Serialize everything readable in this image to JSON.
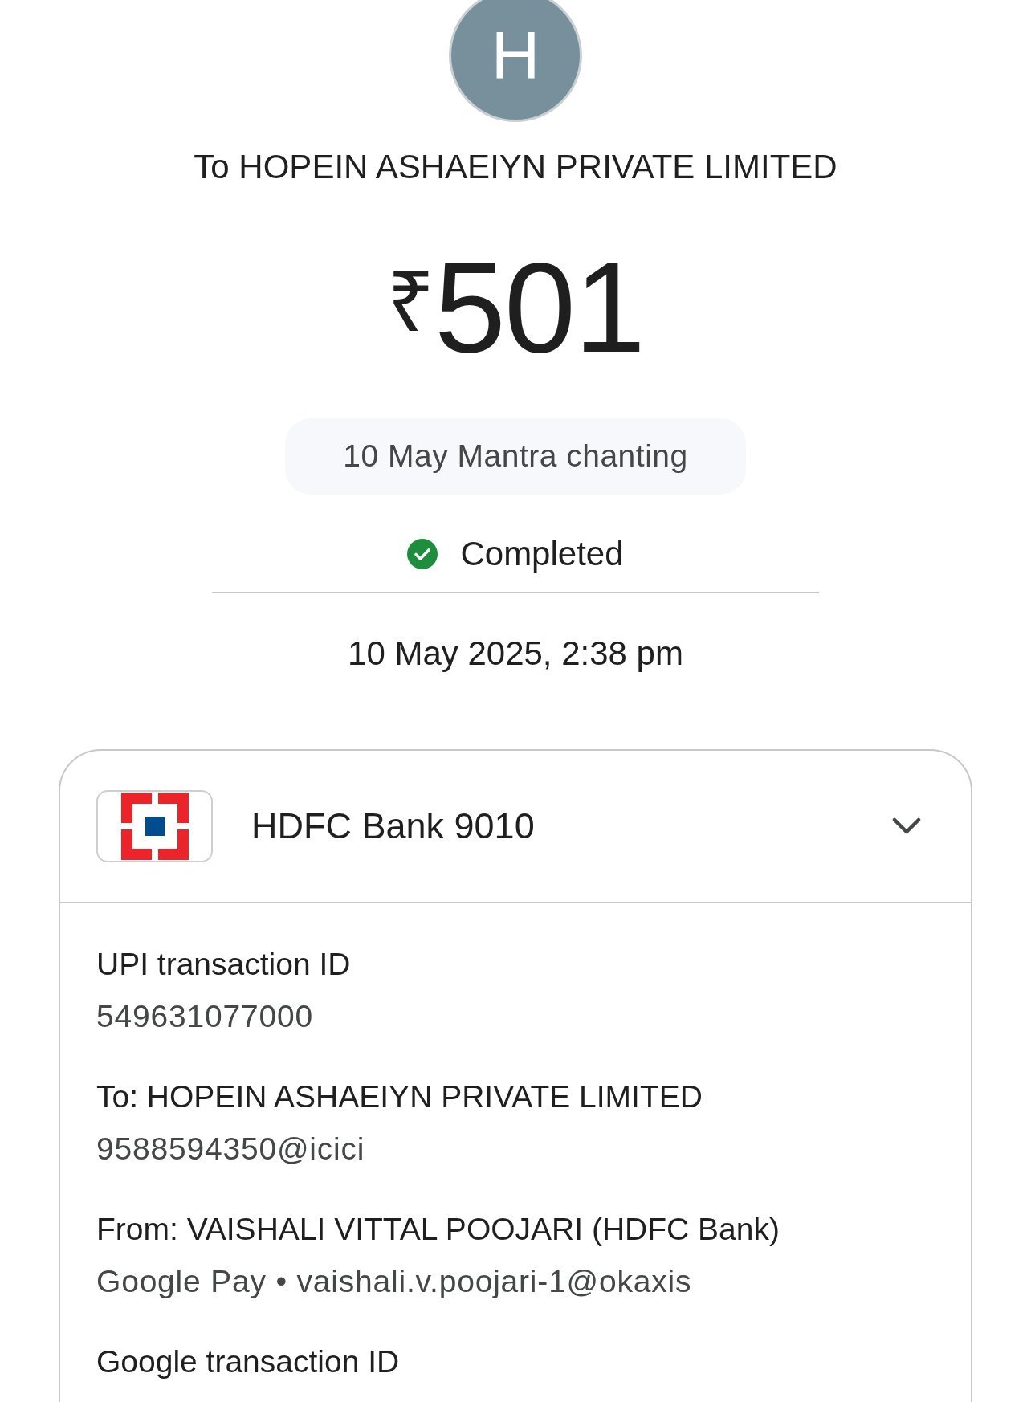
{
  "recipient": {
    "avatar_letter": "H",
    "title": "To HOPEIN ASHAEIYN PRIVATE LIMITED"
  },
  "amount": {
    "currency": "₹",
    "value": "501"
  },
  "note": "10 May Mantra chanting",
  "status": {
    "kind": "completed",
    "label": "Completed"
  },
  "timestamp": "10 May 2025, 2:38 pm",
  "account_card": {
    "bank": "HDFC Bank 9010",
    "details": [
      {
        "label": "UPI transaction ID",
        "value": "549631077000"
      },
      {
        "label": "To: HOPEIN ASHAEIYN PRIVATE LIMITED",
        "value": "9588594350@icici"
      },
      {
        "label": "From: VAISHALI VITTAL POOJARI (HDFC Bank)",
        "value": "Google Pay • vaishali.v.poojari-1@okaxis"
      },
      {
        "label": "Google transaction ID"
      }
    ]
  }
}
